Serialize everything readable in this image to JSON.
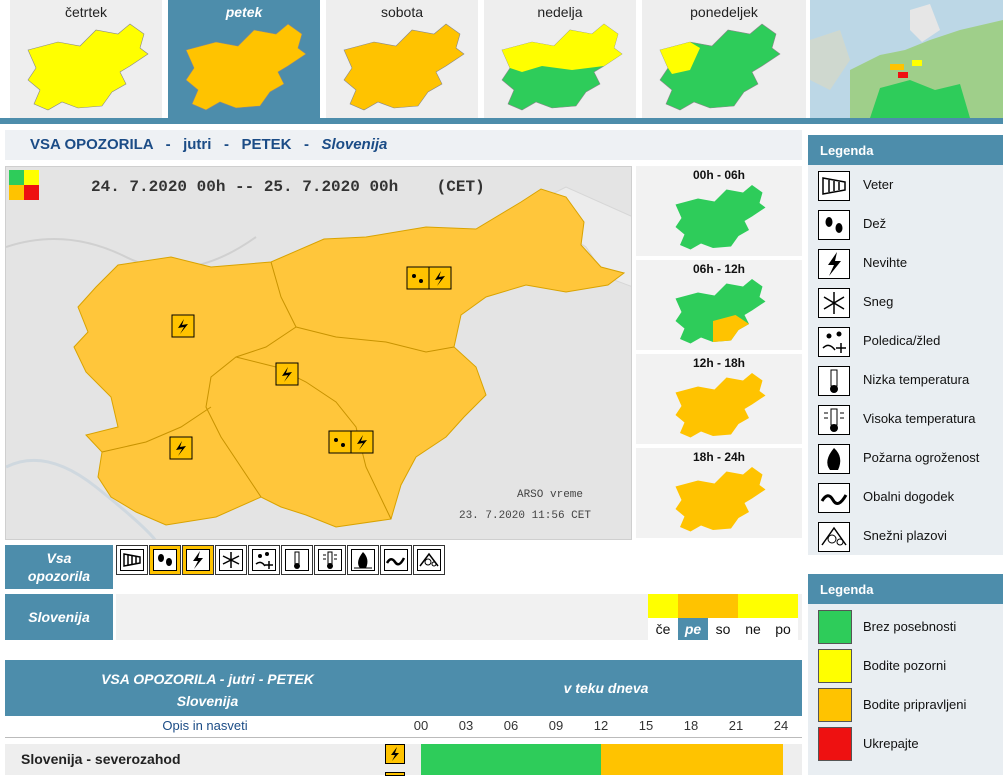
{
  "colors": {
    "green": "#2ecc5a",
    "yellow": "#ffff00",
    "orange": "#ffc300",
    "red": "#ee1111",
    "accent": "#4d8dab"
  },
  "days": [
    {
      "label": "četrtek",
      "color": "#ffff00",
      "active": false
    },
    {
      "label": "petek",
      "color": "#ffc300",
      "active": true
    },
    {
      "label": "sobota",
      "color": "#ffc300",
      "active": false
    },
    {
      "label": "nedelja",
      "color": "#ffff00",
      "active": false
    },
    {
      "label": "ponedeljek",
      "color": "#2ecc5a",
      "active": false
    }
  ],
  "header": {
    "title": "VSA OPOZORILA",
    "sep": "-",
    "when": "jutri",
    "day": "PETEK",
    "region": "Slovenija"
  },
  "map": {
    "range": "24. 7.2020 00h -- 25. 7.2020 00h    (CET)",
    "source": "ARSO vreme",
    "issued": "23. 7.2020  11:56 CET"
  },
  "intervals": [
    {
      "label": "00h - 06h",
      "color": "#2ecc5a"
    },
    {
      "label": "06h - 12h",
      "color": "#2ecc5a"
    },
    {
      "label": "12h - 18h",
      "color": "#ffc300"
    },
    {
      "label": "18h - 24h",
      "color": "#ffc300"
    }
  ],
  "filter": {
    "label_line1": "Vsa",
    "label_line2": "opozorila",
    "icons": [
      {
        "name": "wind-icon",
        "on": false
      },
      {
        "name": "rain-icon",
        "on": true
      },
      {
        "name": "thunderstorm-icon",
        "on": true
      },
      {
        "name": "snow-icon",
        "on": false
      },
      {
        "name": "ice-icon",
        "on": false
      },
      {
        "name": "low-temperature-icon",
        "on": false
      },
      {
        "name": "high-temperature-icon",
        "on": false
      },
      {
        "name": "fire-icon",
        "on": false
      },
      {
        "name": "coastal-icon",
        "on": false
      },
      {
        "name": "avalanche-icon",
        "on": false
      }
    ]
  },
  "slovenija": {
    "label": "Slovenija",
    "days": [
      {
        "abbr": "če",
        "color": "#ffff00",
        "selected": false
      },
      {
        "abbr": "pe",
        "color": "#ffc300",
        "selected": true
      },
      {
        "abbr": "so",
        "color": "#ffc300",
        "selected": false
      },
      {
        "abbr": "ne",
        "color": "#ffff00",
        "selected": false
      },
      {
        "abbr": "po",
        "color": "#ffff00",
        "selected": false
      }
    ]
  },
  "table": {
    "title_line1": "VSA OPOZORILA - jutri - PETEK",
    "title_line2": "Slovenija",
    "during": "v teku dneva",
    "opis": "Opis in nasveti",
    "hours": [
      "00",
      "03",
      "06",
      "09",
      "12",
      "15",
      "18",
      "21",
      "24"
    ],
    "rows": [
      {
        "name": "Slovenija - severozahod"
      }
    ]
  },
  "legend_icons": {
    "title": "Legenda",
    "items": [
      {
        "icon": "wind-icon",
        "label": "Veter"
      },
      {
        "icon": "rain-icon",
        "label": "Dež"
      },
      {
        "icon": "thunderstorm-icon",
        "label": "Nevihte"
      },
      {
        "icon": "snow-icon",
        "label": "Sneg"
      },
      {
        "icon": "ice-icon",
        "label": "Poledica/žled"
      },
      {
        "icon": "low-temperature-icon",
        "label": "Nizka temperatura"
      },
      {
        "icon": "high-temperature-icon",
        "label": "Visoka temperatura"
      },
      {
        "icon": "fire-icon",
        "label": "Požarna ogroženost"
      },
      {
        "icon": "coastal-icon",
        "label": "Obalni dogodek"
      },
      {
        "icon": "avalanche-icon",
        "label": "Snežni plazovi"
      }
    ]
  },
  "legend_colors": {
    "title": "Legenda",
    "items": [
      {
        "color": "#2ecc5a",
        "label": "Brez posebnosti"
      },
      {
        "color": "#ffff00",
        "label": "Bodite pozorni"
      },
      {
        "color": "#ffc300",
        "label": "Bodite pripravljeni"
      },
      {
        "color": "#ee1111",
        "label": "Ukrepajte"
      }
    ]
  }
}
